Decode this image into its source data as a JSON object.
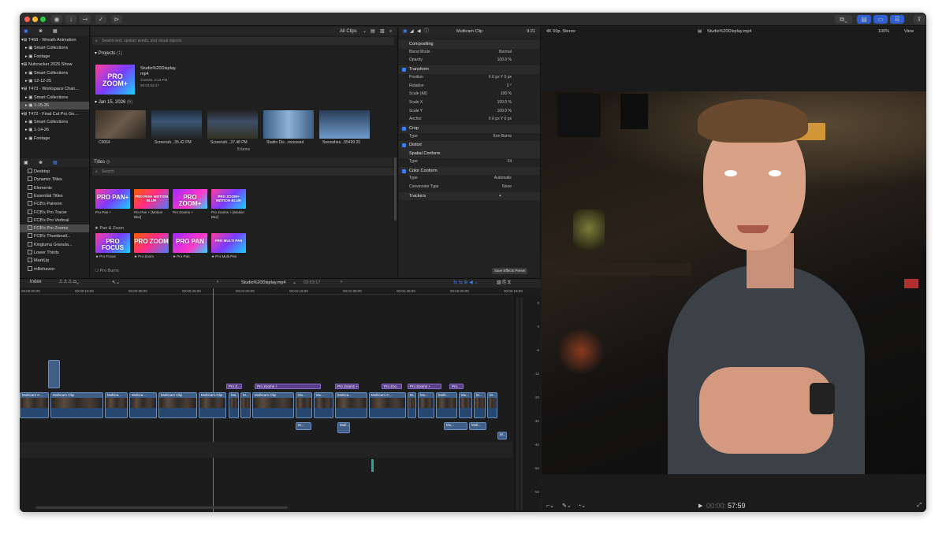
{
  "toolbar": {
    "traffic_colors": [
      "#ff5f57",
      "#febc2e",
      "#28c840"
    ]
  },
  "sidebar": {
    "top_items": [
      {
        "label": "T468 - Wreath Animation",
        "indent": 0,
        "selected": false
      },
      {
        "label": "Smart Collections",
        "indent": 1,
        "selected": false
      },
      {
        "label": "Footage",
        "indent": 1,
        "selected": false
      },
      {
        "label": "Nutcracker 2025 Show",
        "indent": 0,
        "selected": false
      },
      {
        "label": "Smart Collections",
        "indent": 1,
        "selected": false
      },
      {
        "label": "12-12-25",
        "indent": 1,
        "selected": false
      },
      {
        "label": "T473 - Workspace Chan...",
        "indent": 0,
        "selected": false
      },
      {
        "label": "Smart Collections",
        "indent": 1,
        "selected": false
      },
      {
        "label": "1-15-26",
        "indent": 1,
        "selected": true
      },
      {
        "label": "T472 - Final Cut Pro Go...",
        "indent": 0,
        "selected": false
      },
      {
        "label": "Smart Collections",
        "indent": 1,
        "selected": false
      },
      {
        "label": "1-14-26",
        "indent": 1,
        "selected": false
      },
      {
        "label": "Footage",
        "indent": 1,
        "selected": false
      }
    ],
    "title_items": [
      {
        "label": "Desktop",
        "selected": false
      },
      {
        "label": "Dynamic Titles",
        "selected": false
      },
      {
        "label": "Elements",
        "selected": false
      },
      {
        "label": "Essential Titles",
        "selected": false
      },
      {
        "label": "FCB's Patreon",
        "selected": false
      },
      {
        "label": "FCB's Pro Tracer",
        "selected": false
      },
      {
        "label": "FCB's Pro Vertical",
        "selected": false
      },
      {
        "label": "FCB's Pro Zooms",
        "selected": true
      },
      {
        "label": "FCB's Thumbnail...",
        "selected": false
      },
      {
        "label": "Kingluma Granula...",
        "selected": false
      },
      {
        "label": "Lower Thirds",
        "selected": false
      },
      {
        "label": "MarkUp",
        "selected": false
      },
      {
        "label": "mBehavior",
        "selected": false
      }
    ]
  },
  "browser": {
    "filter": "All Clips",
    "search_placeholder": "Search text, spoken words, and visual objects",
    "projects_label": "Projects",
    "projects_count": "(1)",
    "project": {
      "name": "Studio%20Display.",
      "name2": "mp4",
      "date": "1/15/26, 2:13 PM",
      "duration": "00:03:53:17",
      "thumb_text": "PRO ZOOM+"
    },
    "date_group": "Jan 15, 2026",
    "date_count": "(6)",
    "clips": [
      {
        "label": "C0064"
      },
      {
        "label": "Screensh...35.42 PM"
      },
      {
        "label": "Screensh...37.48 PM"
      },
      {
        "label": "Studio Dis...rocessed"
      },
      {
        "label": "Swooshes...55499 20"
      }
    ],
    "items_count": "8 items"
  },
  "titles": {
    "header": "Titles",
    "search_placeholder": "Search",
    "row1": [
      {
        "text": "PRO PAN+",
        "caption": "Pro Pan +"
      },
      {
        "text": "PRO PAN+ MOTION BLUR",
        "caption": "Pro Pan + [Motion Blur]"
      },
      {
        "text": "PRO ZOOM+",
        "caption": "Pro Zooms +"
      },
      {
        "text": "PRO ZOOM+ MOTION BLUR",
        "caption": "Pro Zooms + [Motion Blur]"
      }
    ],
    "group": "Pan & Zoom",
    "row2": [
      {
        "text": "PRO FOCUS",
        "caption": "Pro Focus"
      },
      {
        "text": "PRO ZOOM",
        "caption": "Pro Zoom"
      },
      {
        "text": "PRO PAN",
        "caption": "Pro Pan"
      },
      {
        "text": "PRO MULTI PAN",
        "caption": "Pro Multi Pan"
      }
    ],
    "group2": "Pro Burns"
  },
  "inspector": {
    "clip_name": "Multicam Clip",
    "duration": "9:21",
    "rows": [
      {
        "k": "Compositing",
        "v": "",
        "type": "sect",
        "check": false
      },
      {
        "k": "Blend Mode",
        "v": "Normal",
        "type": "row"
      },
      {
        "k": "Opacity",
        "v": "100.0 %",
        "type": "row"
      },
      {
        "k": "Transform",
        "v": "",
        "type": "sect",
        "check": true
      },
      {
        "k": "Position",
        "v": "X 0 px  Y 0 px",
        "type": "row"
      },
      {
        "k": "Rotation",
        "v": "0 °",
        "type": "row"
      },
      {
        "k": "Scale (All)",
        "v": "100 %",
        "type": "row"
      },
      {
        "k": "Scale X",
        "v": "100.0 %",
        "type": "row"
      },
      {
        "k": "Scale Y",
        "v": "100.0 %",
        "type": "row"
      },
      {
        "k": "Anchor",
        "v": "X 0 px  Y 0 px",
        "type": "row"
      },
      {
        "k": "Crop",
        "v": "",
        "type": "sect",
        "check": true
      },
      {
        "k": "Type",
        "v": "Ken Burns",
        "type": "row"
      },
      {
        "k": "Distort",
        "v": "",
        "type": "sect",
        "check": true
      },
      {
        "k": "Spatial Conform",
        "v": "",
        "type": "sect",
        "check": false
      },
      {
        "k": "Type",
        "v": "Fit",
        "type": "row"
      },
      {
        "k": "Color Conform",
        "v": "",
        "type": "sect",
        "check": true
      },
      {
        "k": "Type",
        "v": "Automatic",
        "type": "row"
      },
      {
        "k": "Conversion Type",
        "v": "None",
        "type": "row"
      },
      {
        "k": "Trackers",
        "v": "+",
        "type": "sect",
        "check": false
      }
    ],
    "save_label": "Save Effects Preset"
  },
  "viewer": {
    "format": "4K 60p, Stereo",
    "title": "Studio%20Display.mp4",
    "zoom": "100%",
    "view": "View",
    "timecode_dim": "00:00:",
    "timecode": "57:59"
  },
  "timeline": {
    "index": "Index",
    "project": "Studio%20Display.mp4",
    "duration": "03:53:17",
    "ruler": [
      "00:00:00:00",
      "00:00:15:00",
      "00:00:30:00",
      "00:00:45:00",
      "00:01:00:00",
      "00:01:15:00",
      "00:01:30:00",
      "00:01:45:00",
      "00:02:00:00",
      "00:02:15:00"
    ],
    "meter_labels": [
      "6",
      "0",
      "-6",
      "-12",
      "-20",
      "-30",
      "-40",
      "-50",
      "-60"
    ],
    "title_clips": [
      {
        "label": "Pro Z..."
      },
      {
        "label": "Pro Zooms +"
      },
      {
        "label": "Pro Zooms +"
      },
      {
        "label": "Pro Zoo..."
      },
      {
        "label": "Pro Zooms +"
      },
      {
        "label": "Pro..."
      }
    ],
    "clips": [
      {
        "label": "Multicam C..."
      },
      {
        "label": "Multicam Clip"
      },
      {
        "label": "Multica..."
      },
      {
        "label": "Multica..."
      },
      {
        "label": "Multicam Clip"
      },
      {
        "label": "Multicam Clip"
      },
      {
        "label": "Mu..."
      },
      {
        "label": "M..."
      },
      {
        "label": "Multicam Clip"
      },
      {
        "label": "Mu..."
      },
      {
        "label": "Mu..."
      },
      {
        "label": "Multica..."
      },
      {
        "label": "Multicam C..."
      },
      {
        "label": "M..."
      },
      {
        "label": "Mu..."
      },
      {
        "label": "Multi..."
      },
      {
        "label": "Mu..."
      },
      {
        "label": "M..."
      },
      {
        "label": "M..."
      }
    ],
    "audio_clips": [
      {
        "label": "M..."
      },
      {
        "label": "Mult..."
      },
      {
        "label": "Mu..."
      },
      {
        "label": "Mult..."
      },
      {
        "label": "M..."
      }
    ]
  }
}
